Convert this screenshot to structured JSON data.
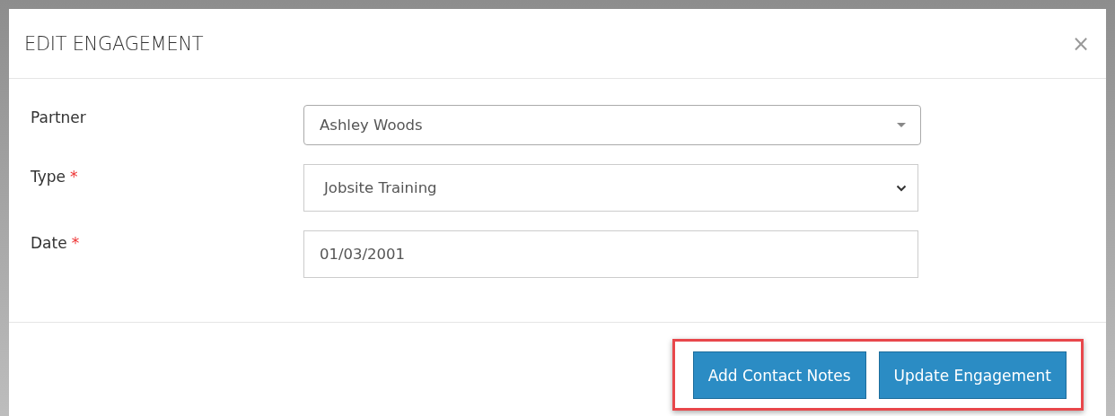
{
  "dialog": {
    "title": "EDIT ENGAGEMENT",
    "close": "×"
  },
  "fields": [
    {
      "kind": "combo",
      "label": "Partner",
      "value": "Ashley Woods"
    },
    {
      "kind": "select",
      "label": "Type",
      "required_mark": "*",
      "value": "Jobsite Training"
    },
    {
      "kind": "text",
      "label": "Date",
      "required_mark": "*",
      "value": "01/03/2001"
    }
  ],
  "footer": {
    "highlighted": true,
    "buttons": [
      "Add Contact Notes",
      "Update Engagement"
    ]
  }
}
